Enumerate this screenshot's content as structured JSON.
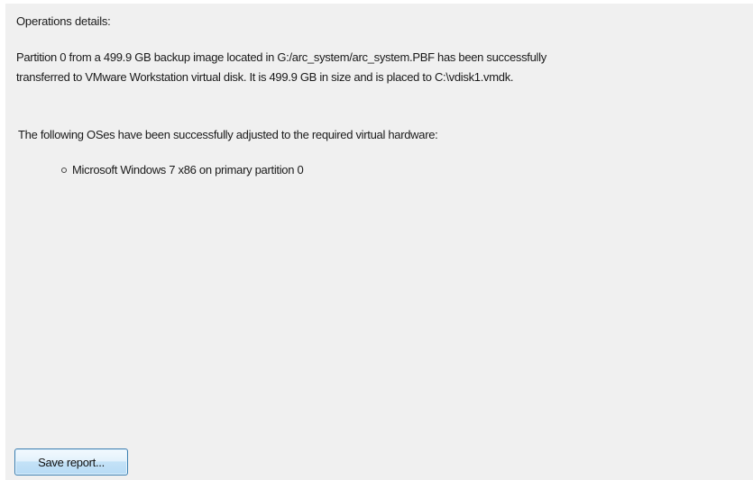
{
  "details": {
    "title": "Operations details:",
    "summary_line1": "Partition 0 from a 499.9 GB backup image located in G:/arc_system/arc_system.PBF has been successfully",
    "summary_line2": "transferred to  VMware Workstation virtual disk. It is 499.9 GB in size and is placed to C:\\vdisk1.vmdk.",
    "os_intro": "The following OSes have been successfully adjusted to the required virtual hardware:",
    "os_list": [
      "Microsoft Windows 7 x86 on primary partition 0"
    ]
  },
  "actions": {
    "save_report_label": "Save report..."
  },
  "icons": {
    "bullet": "circle-bullet-icon"
  }
}
